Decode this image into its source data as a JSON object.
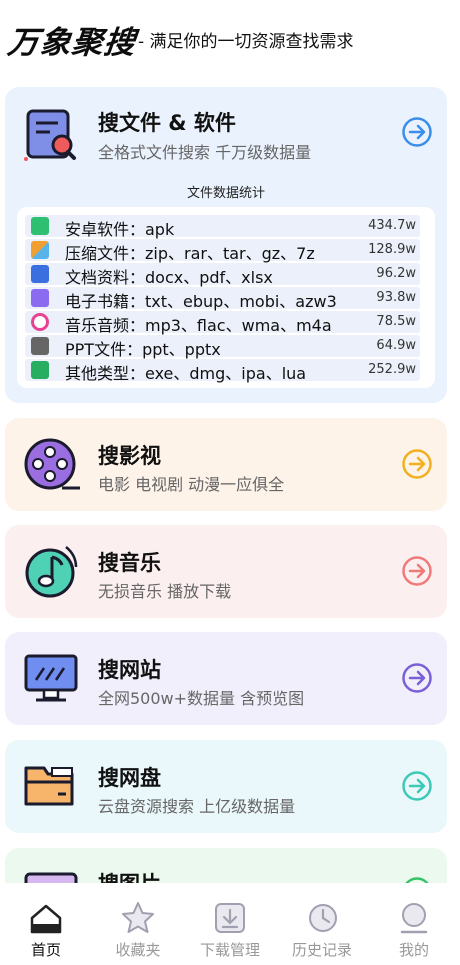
{
  "header": {
    "logo": "万象聚搜",
    "slogan": "- 满足你的一切资源查找需求"
  },
  "cards": {
    "files": {
      "title": "搜文件 & 软件",
      "subtitle": "全格式文件搜索 千万级数据量",
      "stats_title": "文件数据统计",
      "icon": "document-search-icon"
    },
    "movie": {
      "title": "搜影视",
      "subtitle": "电影 电视剧 动漫一应俱全",
      "icon": "film-reel-icon"
    },
    "music": {
      "title": "搜音乐",
      "subtitle": "无损音乐 播放下载",
      "icon": "music-note-icon"
    },
    "site": {
      "title": "搜网站",
      "subtitle": "全网500w+数据量 含预览图",
      "icon": "monitor-icon"
    },
    "disk": {
      "title": "搜网盘",
      "subtitle": "云盘资源搜索 上亿级数据量",
      "icon": "folder-icon"
    },
    "image": {
      "title": "搜图片",
      "icon": "image-icon"
    }
  },
  "stats": [
    {
      "label": "安卓软件：apk",
      "count": "434.7w",
      "icon": "android-icon",
      "color": "#2fbf71"
    },
    {
      "label": "压缩文件：zip、rar、tar、gz、7z",
      "count": "128.9w",
      "icon": "archive-icon",
      "color": "#f0a030"
    },
    {
      "label": "文档资料：docx、pdf、xlsx",
      "count": "96.2w",
      "icon": "word-doc-icon",
      "color": "#3b6fe0"
    },
    {
      "label": "电子书籍：txt、ebup、mobi、azw3",
      "count": "93.8w",
      "icon": "ebook-icon",
      "color": "#8b6cf0"
    },
    {
      "label": "音乐音频：mp3、flac、wma、m4a",
      "count": "78.5w",
      "icon": "audio-icon",
      "color": "#e84393"
    },
    {
      "label": "PPT文件：ppt、pptx",
      "count": "64.9w",
      "icon": "ppt-icon",
      "color": "#666666"
    },
    {
      "label": "其他类型：exe、dmg、ipa、lua",
      "count": "252.9w",
      "icon": "other-file-icon",
      "color": "#27ae60"
    }
  ],
  "tabs": [
    {
      "label": "首页",
      "icon": "home-icon",
      "active": true
    },
    {
      "label": "收藏夹",
      "icon": "star-icon"
    },
    {
      "label": "下载管理",
      "icon": "download-icon"
    },
    {
      "label": "历史记录",
      "icon": "history-icon"
    },
    {
      "label": "我的",
      "icon": "profile-icon"
    }
  ],
  "colors": {
    "files_arrow": "#3b8fe8",
    "movie_arrow": "#f2b01e",
    "music_arrow": "#ef7a7a",
    "site_arrow": "#7b5fd6",
    "disk_arrow": "#3cc9b8",
    "image_arrow": "#36c26a"
  }
}
